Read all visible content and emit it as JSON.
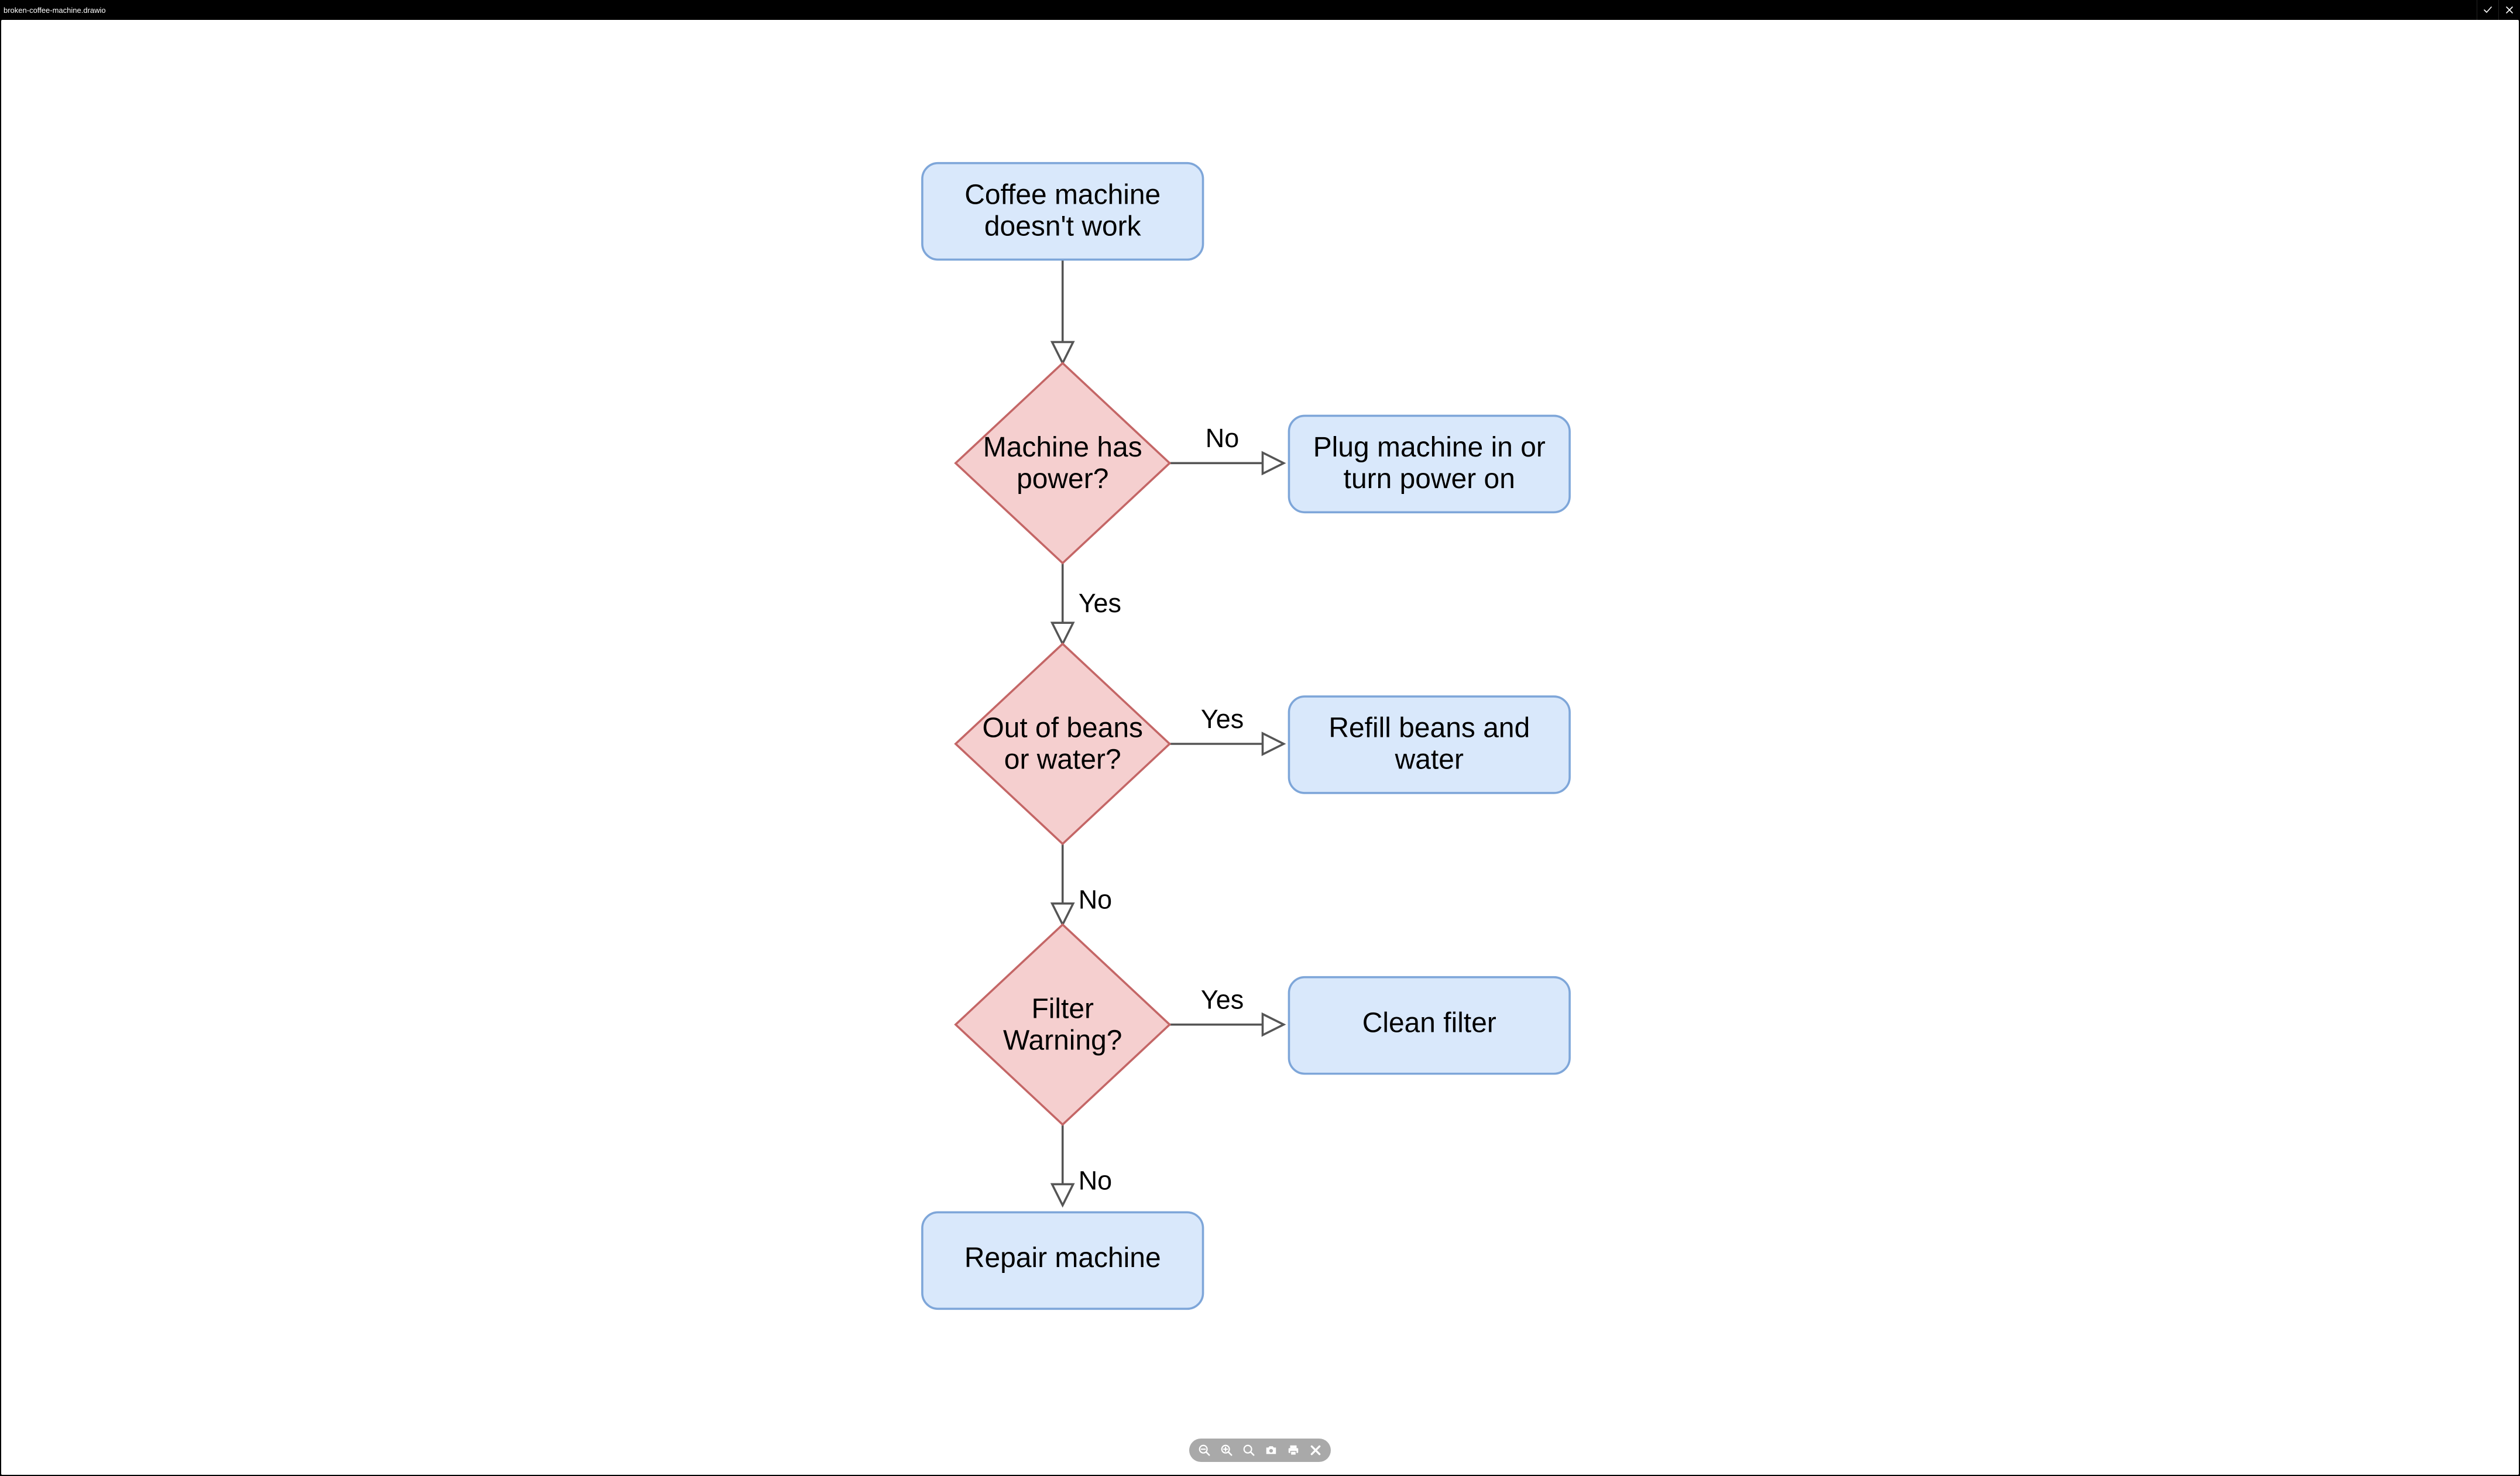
{
  "titlebar": {
    "filename": "broken-coffee-machine.drawio"
  },
  "flowchart": {
    "nodes": {
      "start": {
        "text_l1": "Coffee machine",
        "text_l2": "doesn't work"
      },
      "power": {
        "text_l1": "Machine has",
        "text_l2": "power?"
      },
      "plug": {
        "text_l1": "Plug machine in or",
        "text_l2": "turn power on"
      },
      "beans": {
        "text_l1": "Out of beans",
        "text_l2": "or water?"
      },
      "refill": {
        "text_l1": "Refill beans and",
        "text_l2": "water"
      },
      "filter": {
        "text_l1": "Filter",
        "text_l2": "Warning?"
      },
      "clean": {
        "text_l1": "Clean filter"
      },
      "repair": {
        "text_l1": "Repair machine"
      }
    },
    "edge_labels": {
      "power_no": "No",
      "power_yes": "Yes",
      "beans_yes": "Yes",
      "beans_no": "No",
      "filter_yes": "Yes",
      "filter_no": "No"
    }
  },
  "toolbar": {
    "zoom_out": "Zoom out",
    "zoom_in": "Zoom in",
    "zoom_fit": "Fit",
    "camera": "Export image",
    "print": "Print",
    "close": "Close"
  }
}
